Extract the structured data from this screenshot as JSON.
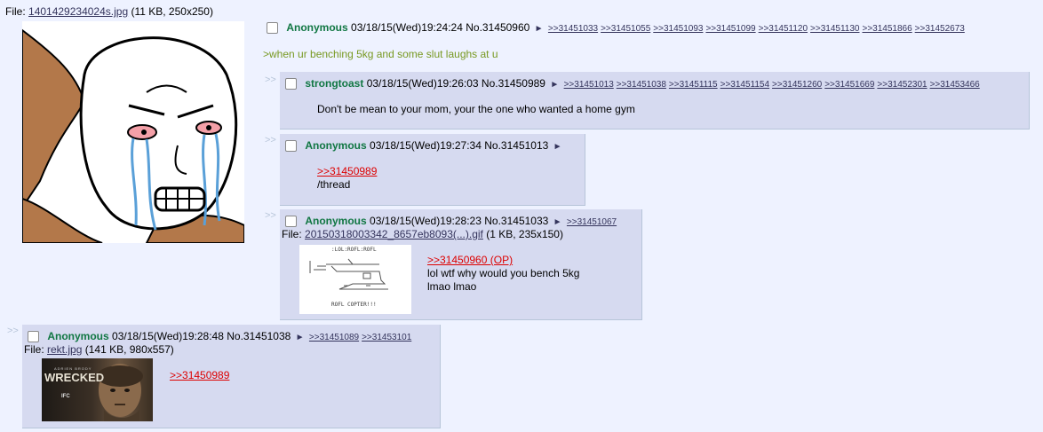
{
  "op": {
    "file_prefix": "File:",
    "file_name": "1401429234024s.jpg",
    "file_meta": "(11 KB, 250x250)",
    "name": "Anonymous",
    "date": "03/18/15(Wed)19:24:24",
    "post_no": "No.31450960",
    "backlinks": [
      ">>31451033",
      ">>31451055",
      ">>31451093",
      ">>31451099",
      ">>31451120",
      ">>31451130",
      ">>31451866",
      ">>31452673"
    ],
    "message": ">when ur benching 5kg and some slut laughs at u"
  },
  "replies": [
    {
      "name": "strongtoast",
      "date": "03/18/15(Wed)19:26:03",
      "post_no": "No.31450989",
      "backlinks": [
        ">>31451013",
        ">>31451038",
        ">>31451115",
        ">>31451154",
        ">>31451260",
        ">>31451669",
        ">>31452301",
        ">>31453466"
      ],
      "message": "Don't be mean to your mom, your the one who wanted a home gym"
    },
    {
      "name": "Anonymous",
      "date": "03/18/15(Wed)19:27:34",
      "post_no": "No.31451013",
      "quote": ">>31450989",
      "message": "/thread"
    },
    {
      "name": "Anonymous",
      "date": "03/18/15(Wed)19:28:23",
      "post_no": "No.31451033",
      "backlinks": [
        ">>31451067"
      ],
      "file_prefix": "File:",
      "file_name": "20150318003342_8657eb8093(...).gif",
      "file_meta": "(1 KB, 235x150)",
      "quote": ">>31450960 (OP)",
      "message_line1": "lol wtf why would you bench 5kg",
      "message_line2": "lmao lmao",
      "thumb_top": ":LOL:ROFL:ROFL",
      "thumb_bottom": "ROFL COPTER!!!"
    },
    {
      "name": "Anonymous",
      "date": "03/18/15(Wed)19:28:48",
      "post_no": "No.31451038",
      "backlinks": [
        ">>31451089",
        ">>31453101"
      ],
      "file_prefix": "File:",
      "file_name": "rekt.jpg",
      "file_meta": "(141 KB, 980x557)",
      "quote": ">>31450989",
      "thumb_title": "WRECKED",
      "thumb_small": "ADRIEN BRODY",
      "thumb_brand": "IFC"
    }
  ],
  "side_arrows": ">>",
  "arrow_glyph": "►",
  "colors": {
    "background": "#eef2ff",
    "reply_bg": "#d6daf0",
    "name_green": "#117743",
    "quote_red": "#d00000",
    "greentext": "#789922"
  }
}
